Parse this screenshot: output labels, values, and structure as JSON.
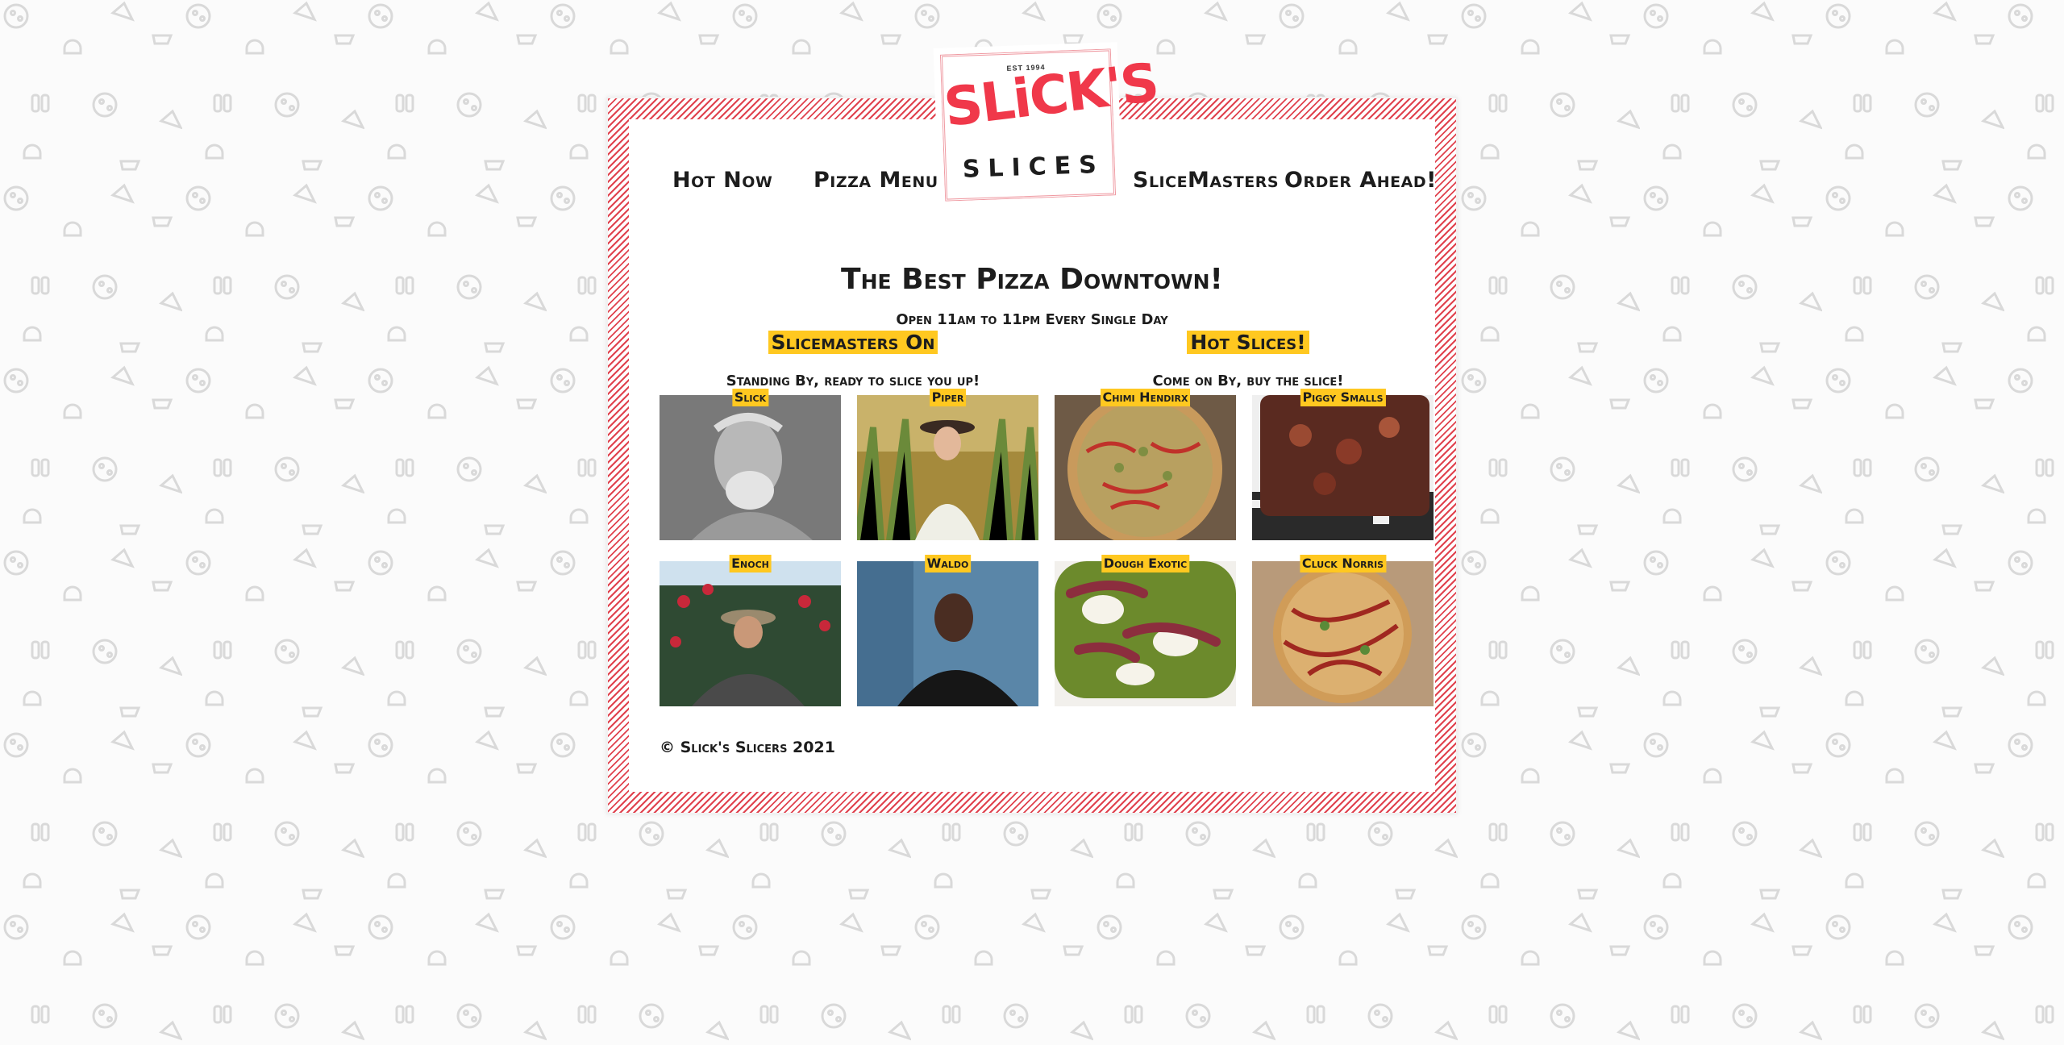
{
  "brand": {
    "est": "EST 1994",
    "name": "SLiCK'S",
    "sub": "SLICES"
  },
  "nav": {
    "items": [
      "Hot Now",
      "Pizza Menu",
      "SliceMasters",
      "Order Ahead!"
    ]
  },
  "hero": {
    "title": "The Best Pizza Downtown!",
    "subtitle": "Open 11am to 11pm Every Single Day"
  },
  "slicemasters": {
    "heading": "Slicemasters On",
    "subheading": "Standing By, ready to slice you up!",
    "people": [
      "Slick",
      "Piper",
      "Enoch",
      "Waldo"
    ]
  },
  "hotslices": {
    "heading": "Hot Slices!",
    "subheading": "Come on By, buy the slice!",
    "pizzas": [
      "Chimi Hendirx",
      "Piggy Smalls",
      "Dough Exotic",
      "Cluck Norris"
    ]
  },
  "footer": {
    "copyright": "© Slick's Slicers 2021"
  },
  "colors": {
    "accent_red": "#e0424e",
    "highlight_yellow": "#ffc820",
    "text": "#1d1d1d",
    "logo_red": "#f0384a"
  }
}
